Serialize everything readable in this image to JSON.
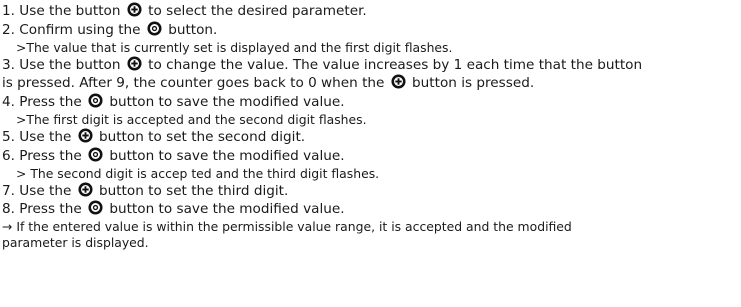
{
  "steps": {
    "s1": {
      "a": "1. Use the button",
      "b": "to select the desired parameter."
    },
    "s2": {
      "a": "2. Confirm using the",
      "b": "button."
    },
    "n1": ">The value that is currently set is displayed and the first digit flashes.",
    "s3": {
      "a": "3. Use the button",
      "b": "to change the value. The value increases by 1 each time that the button",
      "c": "is pressed. After 9, the counter goes back to 0 when the",
      "d": "button is pressed."
    },
    "s4": {
      "a": "4. Press the",
      "b": "button to save the modified value."
    },
    "n2": ">The first digit is accepted and the second digit flashes.",
    "s5": {
      "a": "5. Use the",
      "b": "button to set the second digit."
    },
    "s6": {
      "a": "6. Press the",
      "b": "button to save the modified value."
    },
    "n3": "> The second digit is accep ted and the third digit flashes.",
    "s7": {
      "a": "7. Use the",
      "b": "button to set the third digit."
    },
    "s8": {
      "a": "8. Press the",
      "b": "button to save the modified value."
    },
    "result": {
      "a": "→ If the entered value is within the permissible value range, it is accepted and the modified",
      "b": "parameter is displayed."
    }
  },
  "icons": {
    "plus": "plus-button-icon",
    "ok": "ok-button-icon"
  }
}
